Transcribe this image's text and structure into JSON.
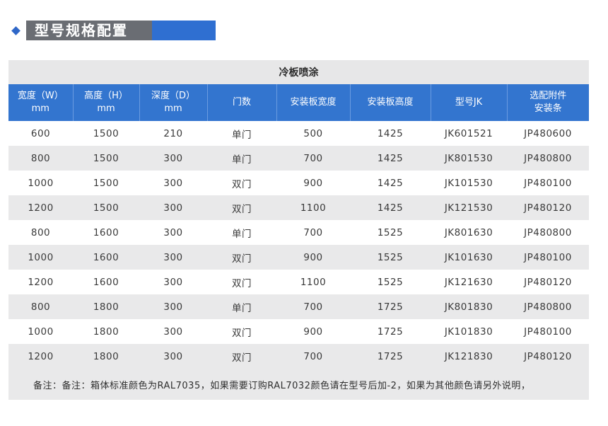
{
  "section_title": "型号规格配置",
  "table": {
    "caption": "冷板喷涂",
    "headers": [
      {
        "line1": "宽度（W）",
        "line2": "mm"
      },
      {
        "line1": "高度（H）",
        "line2": "mm"
      },
      {
        "line1": "深度（D）",
        "line2": "mm"
      },
      {
        "line1": "门数",
        "line2": ""
      },
      {
        "line1": "安装板宽度",
        "line2": ""
      },
      {
        "line1": "安装板高度",
        "line2": ""
      },
      {
        "line1": "型号JK",
        "line2": ""
      },
      {
        "line1": "选配附件",
        "line2": "安装条"
      }
    ],
    "rows": [
      [
        "600",
        "1500",
        "210",
        "单门",
        "500",
        "1425",
        "JK601521",
        "JP480600"
      ],
      [
        "800",
        "1500",
        "300",
        "单门",
        "700",
        "1425",
        "JK801530",
        "JP480800"
      ],
      [
        "1000",
        "1500",
        "300",
        "双门",
        "900",
        "1425",
        "JK101530",
        "JP480100"
      ],
      [
        "1200",
        "1500",
        "300",
        "双门",
        "1100",
        "1425",
        "JK121530",
        "JP480120"
      ],
      [
        "800",
        "1600",
        "300",
        "单门",
        "700",
        "1525",
        "JK801630",
        "JP480800"
      ],
      [
        "1000",
        "1600",
        "300",
        "双门",
        "900",
        "1525",
        "JK101630",
        "JP480100"
      ],
      [
        "1200",
        "1600",
        "300",
        "双门",
        "1100",
        "1525",
        "JK121630",
        "JP480120"
      ],
      [
        "800",
        "1800",
        "300",
        "单门",
        "700",
        "1725",
        "JK801830",
        "JP480800"
      ],
      [
        "1000",
        "1800",
        "300",
        "双门",
        "900",
        "1725",
        "JK101830",
        "JP480100"
      ],
      [
        "1200",
        "1800",
        "300",
        "双门",
        "700",
        "1725",
        "JK121830",
        "JP480120"
      ]
    ],
    "note": "备注：备注：箱体标准颜色为RAL7035，如果需要订购RAL7032颜色请在型号后加-2，如果为其他颜色请另外说明，"
  },
  "colors": {
    "accent": "#3375cf",
    "title_bg": "#6a6d73",
    "row_alt": "#e9e9ea"
  }
}
